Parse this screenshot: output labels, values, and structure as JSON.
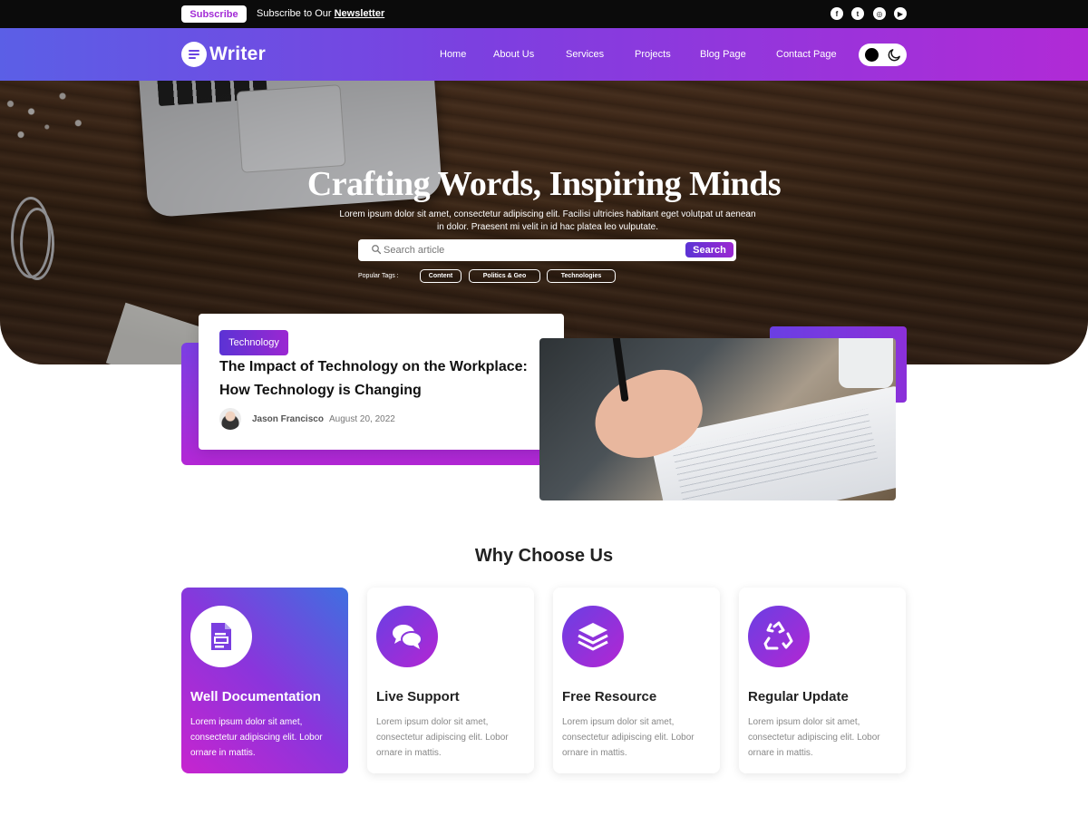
{
  "topbar": {
    "subscribe_label": "Subscribe",
    "newsletter_prefix": "Subscribe to Our ",
    "newsletter_link": "Newsletter",
    "social": [
      {
        "icon": "facebook-icon",
        "glyph": "f"
      },
      {
        "icon": "twitter-icon",
        "glyph": "t"
      },
      {
        "icon": "instagram-icon",
        "glyph": "◎"
      },
      {
        "icon": "youtube-icon",
        "glyph": "▶"
      }
    ]
  },
  "nav": {
    "brand": "Writer",
    "links": [
      "Home",
      "About Us",
      "Services",
      "Projects",
      "Blog Page",
      "Contact Page"
    ],
    "theme_toggle": {
      "light_icon": "circle-icon",
      "dark_icon": "moon-icon"
    }
  },
  "hero": {
    "title": "Crafting Words, Inspiring Minds",
    "description": "Lorem ipsum dolor sit amet, consectetur adipiscing elit. Facilisi ultricies habitant eget volutpat ut aenean in dolor. Praesent mi velit in id hac platea leo vulputate.",
    "search": {
      "placeholder": "Search article",
      "button": "Search"
    },
    "tags_label": "Popular Tags :",
    "tags": [
      "Content",
      "Politics & Geo",
      "Technologies"
    ]
  },
  "featured": {
    "category": "Technology",
    "title": "The Impact of Technology on the Workplace: How Technology is Changing",
    "author": "Jason Francisco",
    "date": "August 20, 2022"
  },
  "why": {
    "title": "Why Choose Us",
    "cards": [
      {
        "icon": "document-icon",
        "title": "Well Documentation",
        "desc": "Lorem ipsum dolor sit amet, consectetur adipiscing elit. Lobor ornare in mattis."
      },
      {
        "icon": "chat-icon",
        "title": "Live Support",
        "desc": "Lorem ipsum dolor sit amet, consectetur adipiscing elit. Lobor ornare in mattis."
      },
      {
        "icon": "layers-icon",
        "title": "Free Resource",
        "desc": "Lorem ipsum dolor sit amet, consectetur adipiscing elit. Lobor ornare in mattis."
      },
      {
        "icon": "recycle-icon",
        "title": "Regular Update",
        "desc": "Lorem ipsum dolor sit amet, consectetur adipiscing elit. Lobor ornare in mattis."
      }
    ]
  },
  "colors": {
    "accent_start": "#5b5fe6",
    "accent_mid": "#7d3fe0",
    "accent_end": "#b12ad6",
    "topbar": "#0b0b0b"
  }
}
